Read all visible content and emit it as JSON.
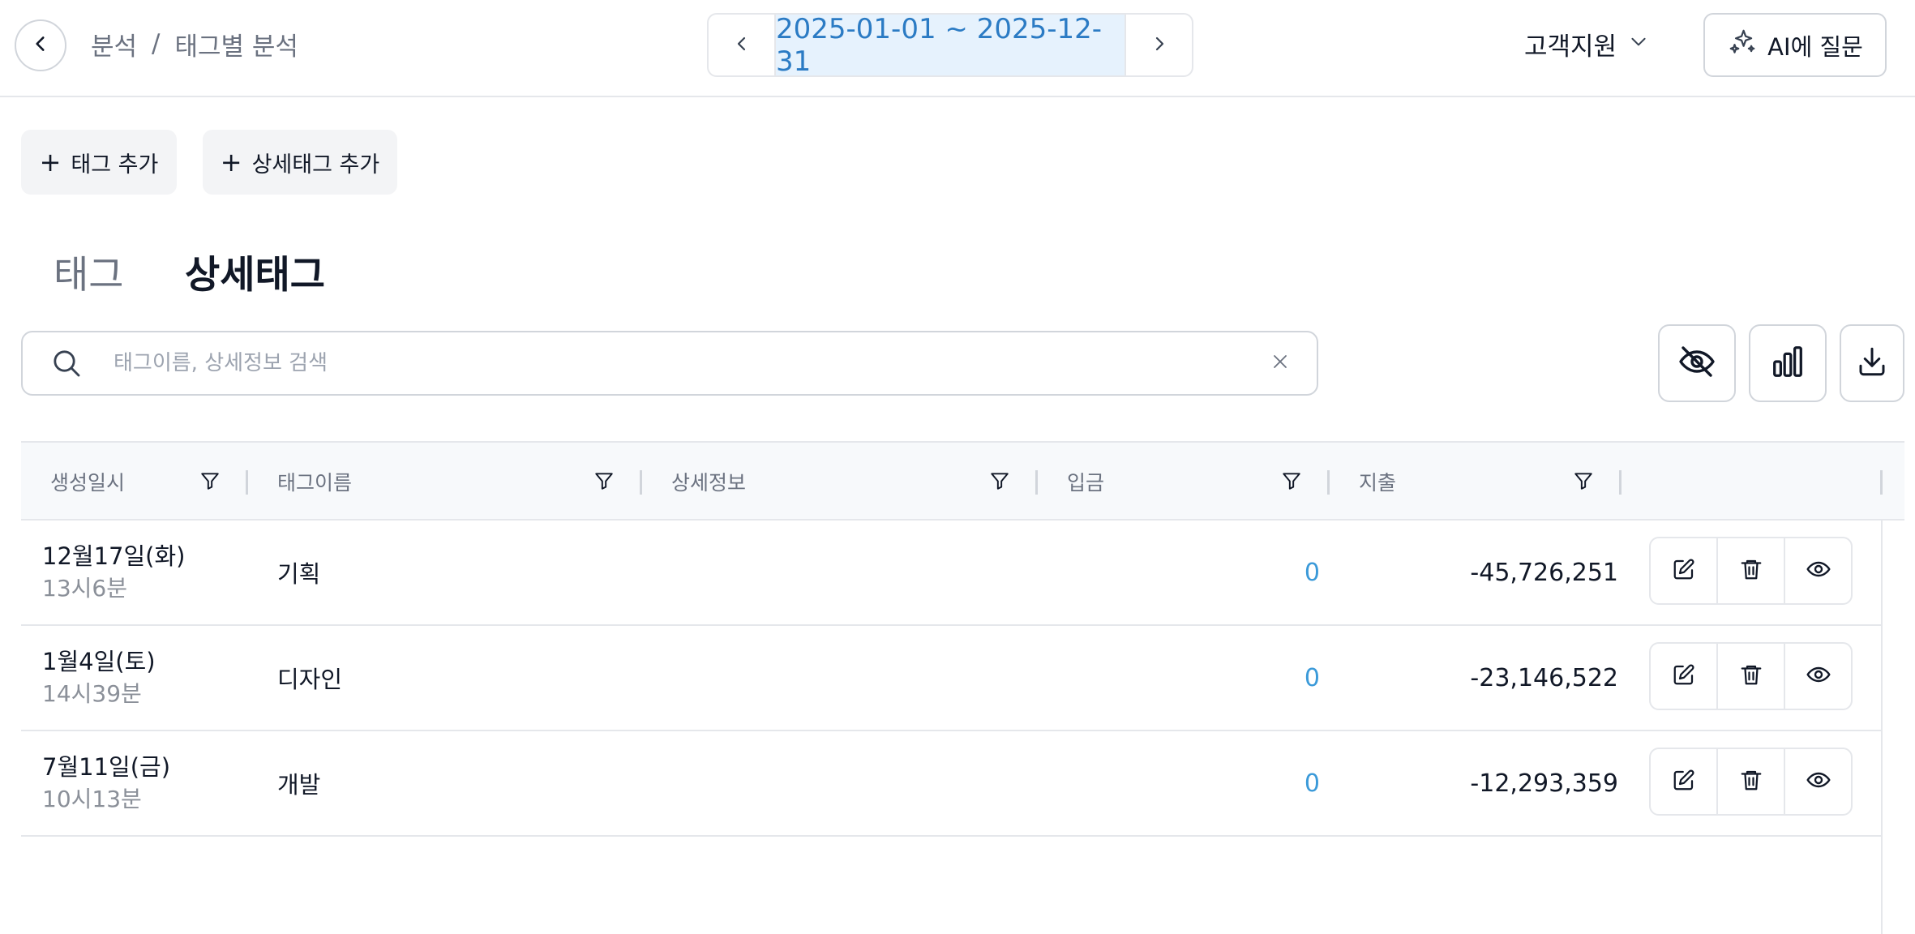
{
  "header": {
    "back_icon": "chevron-left-icon",
    "breadcrumb": [
      "분석",
      "태그별 분석"
    ],
    "breadcrumb_separator": "/",
    "date_range": "2025-01-01 ~ 2025-12-31",
    "support_menu": "고객지원",
    "ai_button": "AI에 질문"
  },
  "actions": {
    "add_tag": "태그 추가",
    "add_detail_tag": "상세태그 추가"
  },
  "tabs": [
    {
      "label": "태그",
      "active": false
    },
    {
      "label": "상세태그",
      "active": true
    }
  ],
  "search": {
    "placeholder": "태그이름, 상세정보 검색",
    "value": ""
  },
  "tools": [
    "eye-off-icon",
    "bar-chart-icon",
    "download-icon"
  ],
  "table": {
    "columns": [
      "생성일시",
      "태그이름",
      "상세정보",
      "입금",
      "지출",
      ""
    ],
    "rows": [
      {
        "date": "12월17일(화)",
        "time": "13시6분",
        "name": "기획",
        "detail": "",
        "deposit": "0",
        "expense": "-45,726,251"
      },
      {
        "date": "1월4일(토)",
        "time": "14시39분",
        "name": "디자인",
        "detail": "",
        "deposit": "0",
        "expense": "-23,146,522"
      },
      {
        "date": "7월11일(금)",
        "time": "10시13분",
        "name": "개발",
        "detail": "",
        "deposit": "0",
        "expense": "-12,293,359"
      }
    ],
    "row_action_icons": [
      "edit-icon",
      "trash-icon",
      "eye-icon"
    ]
  },
  "colors": {
    "accent": "#2b7bc4",
    "date_range_bg": "#e6f2fd",
    "deposit": "#3b9ad9",
    "muted": "#6b7280"
  }
}
